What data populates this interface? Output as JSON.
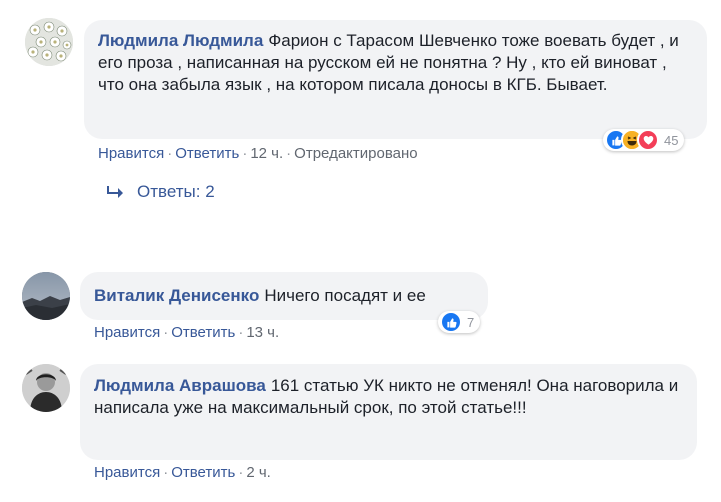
{
  "comments": [
    {
      "author": "Людмила Людмила",
      "text": "Фарион с Тарасом Шевченко тоже воевать будет , и его проза , написанная на русском ей не понятна ? Ну , кто ей виноват , что она забыла язык , на котором писала доносы в КГБ. Бывает.",
      "like_label": "Нравится",
      "reply_label": "Ответить",
      "time": "12 ч.",
      "edited_label": "Отредактировано",
      "reaction_count": "45",
      "reaction_icons": [
        "like-icon",
        "haha-icon",
        "love-icon"
      ],
      "replies_label": "Ответы: 2"
    },
    {
      "author": "Виталик Денисенко",
      "text": "Ничего посадят и ее",
      "like_label": "Нравится",
      "reply_label": "Ответить",
      "time": "13 ч.",
      "reaction_count": "7",
      "reaction_icons": [
        "like-icon"
      ]
    },
    {
      "author": "Людмила Аврашова",
      "text": "161 статью УК никто не отменял! Она наговорила и написала уже на максимальный срок, по этой статье!!!",
      "like_label": "Нравится",
      "reply_label": "Ответить",
      "time": "2 ч."
    }
  ],
  "colors": {
    "link": "#385898",
    "bubble": "#f2f3f5",
    "meta": "#616770",
    "like": "#1877f2",
    "love": "#f33e58",
    "haha": "#f7b125"
  }
}
